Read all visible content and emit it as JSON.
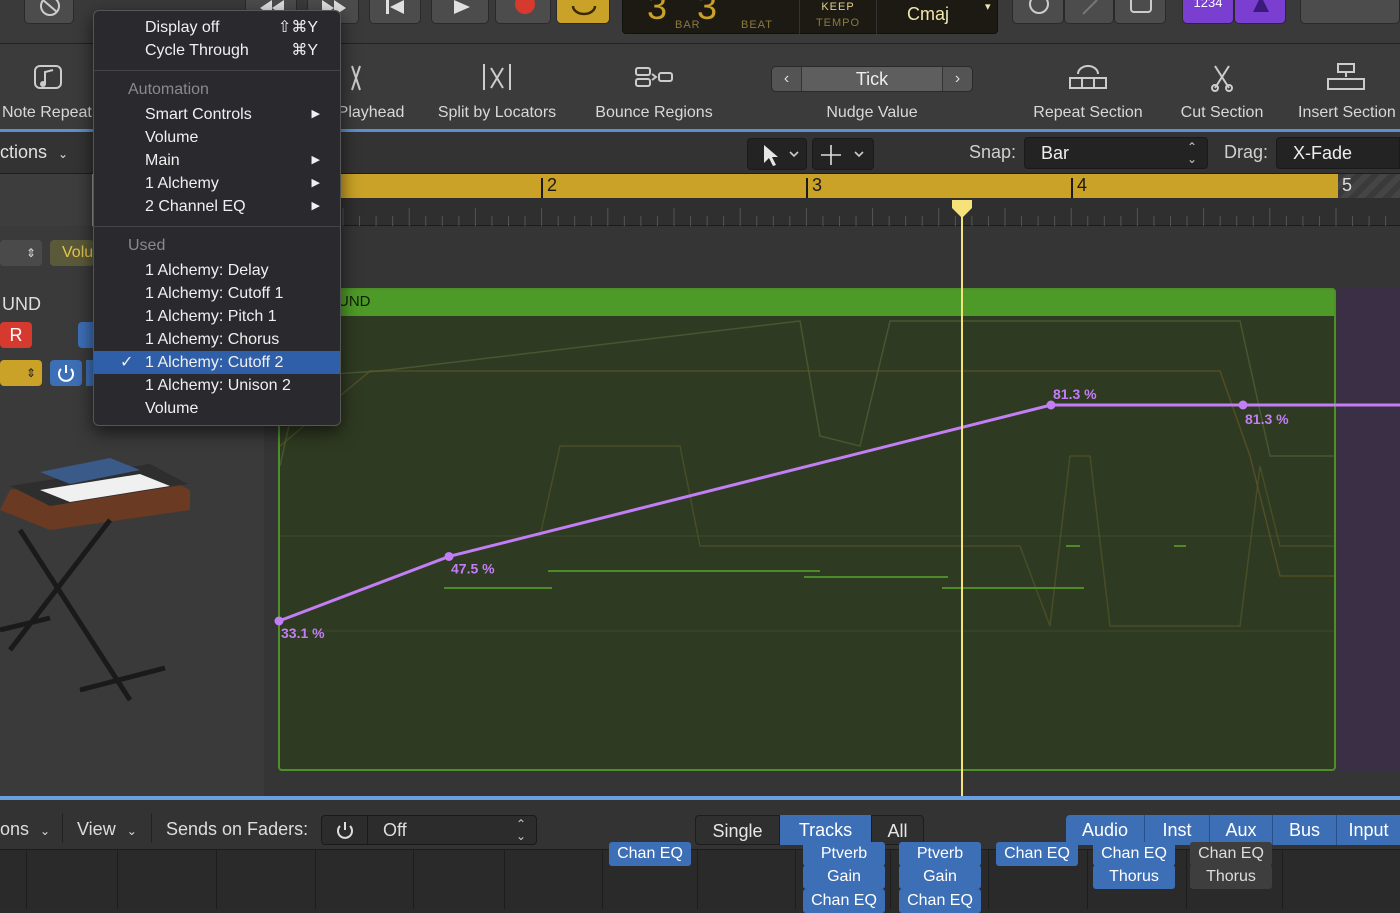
{
  "transport": {
    "lcd_bar_label": "BAR",
    "lcd_beat_label": "BEAT",
    "keep_label": "KEEP",
    "tempo_label": "TEMPO",
    "key": "Cmaj",
    "count_in": "1234"
  },
  "toolbar": {
    "note_repeat": "Note Repeat",
    "playhead": "Playhead",
    "split_by_locators": "Split by Locators",
    "bounce_regions": "Bounce Regions",
    "nudge_value_label": "Nudge Value",
    "nudge_value": "Tick",
    "repeat_section": "Repeat Section",
    "cut_section": "Cut Section",
    "insert_section": "Insert Section"
  },
  "tracks_header": {
    "functions": "ctions",
    "snap_label": "Snap:",
    "snap_value": "Bar",
    "drag_label": "Drag:",
    "drag_value": "X-Fade"
  },
  "ruler": {
    "bars": [
      "2",
      "3",
      "4",
      "5"
    ]
  },
  "track": {
    "volume_chip": "Volu",
    "name_partial": "UND",
    "record_label": "R",
    "region_name": "UND"
  },
  "automation_points": [
    {
      "value": 33.1,
      "label": "33.1 %"
    },
    {
      "value": 47.5,
      "label": "47.5 %"
    },
    {
      "value": 81.3,
      "label": "81.3 %"
    },
    {
      "value": 81.3,
      "label": "81.3 %"
    }
  ],
  "menu": {
    "items_top": [
      {
        "label": "Display off",
        "shortcut": "⇧⌘Y"
      },
      {
        "label": "Cycle Through",
        "shortcut": "⌘Y"
      }
    ],
    "automation_header": "Automation",
    "automation_items": [
      {
        "label": "Smart Controls",
        "submenu": true
      },
      {
        "label": "Volume",
        "submenu": false
      },
      {
        "label": "Main",
        "submenu": true
      },
      {
        "label": "1 Alchemy",
        "submenu": true
      },
      {
        "label": "2 Channel EQ",
        "submenu": true
      }
    ],
    "used_header": "Used",
    "used_items": [
      {
        "label": "1 Alchemy: Delay",
        "checked": false
      },
      {
        "label": "1 Alchemy: Cutoff 1",
        "checked": false
      },
      {
        "label": "1 Alchemy: Pitch 1",
        "checked": false
      },
      {
        "label": "1 Alchemy: Chorus",
        "checked": false
      },
      {
        "label": "1 Alchemy: Cutoff 2",
        "checked": true
      },
      {
        "label": "1 Alchemy: Unison 2",
        "checked": false
      },
      {
        "label": "Volume",
        "checked": false
      }
    ],
    "checkmark": "✓",
    "submenu_arrow": "▶"
  },
  "mixer_bar": {
    "options": "ons",
    "view": "View",
    "sends_label": "Sends on Faders:",
    "sends_value": "Off",
    "modes": [
      "Single",
      "Tracks",
      "All"
    ],
    "active_mode": "Tracks",
    "types": [
      "Audio",
      "Inst",
      "Aux",
      "Bus",
      "Input"
    ]
  },
  "mixer_plugins": {
    "strip1": [
      "Chan EQ"
    ],
    "strip2": [
      "Ptverb",
      "Gain",
      "Chan EQ"
    ],
    "strip3": [
      "Ptverb",
      "Gain",
      "Chan EQ"
    ],
    "strip4": [
      "Chan EQ"
    ],
    "strip5": [
      "Chan EQ",
      "Thorus"
    ],
    "strip6": [
      "Chan EQ",
      "Thorus"
    ]
  },
  "colors": {
    "accent_blue": "#3d6fb6",
    "cycle_yellow": "#c9a227",
    "region_green": "#4e9a28",
    "automation_purple": "#c27ef5",
    "playhead": "#f5e37a",
    "record_red": "#d63a2f"
  }
}
